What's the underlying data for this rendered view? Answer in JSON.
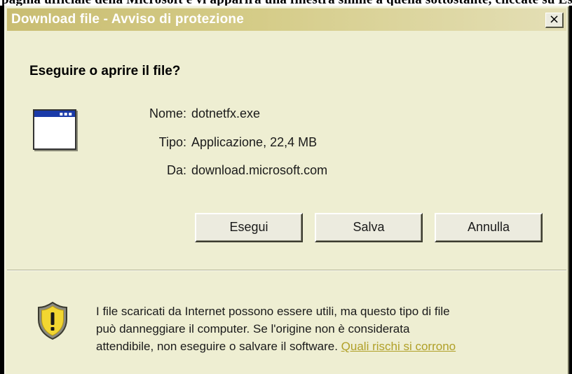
{
  "cut_text": "pagina ufficiale della Microsoft e vi apparirà una finestra simile a quella sottostante, cliccate su Esegui ed attendete che il programma venga",
  "dialog": {
    "title": "Download file - Avviso di protezione",
    "close_label": "×",
    "question": "Eseguire o aprire il file?",
    "icon": "application-window-icon",
    "file_info": {
      "name_label": "Nome:",
      "name_value": "dotnetfx.exe",
      "type_label": "Tipo:",
      "type_value": "Applicazione, 22,4 MB",
      "from_label": "Da:",
      "from_value": "download.microsoft.com"
    },
    "buttons": {
      "run": "Esegui",
      "save": "Salva",
      "cancel": "Annulla"
    },
    "warning": {
      "icon": "security-shield-warning-icon",
      "line1": "I file scaricati da Internet possono essere utili, ma questo tipo di file",
      "line2": "può danneggiare il computer. Se l'origine non è considerata",
      "line3": "attendibile, non eseguire o salvare il software.",
      "link": "Quali rischi si corrono"
    }
  },
  "colors": {
    "dialog_background": "#eeeed2",
    "titlebar_start": "#c9bd72",
    "titlebar_end": "#e4dfb6",
    "link": "#b0a028",
    "shield_yellow": "#f2d631"
  }
}
